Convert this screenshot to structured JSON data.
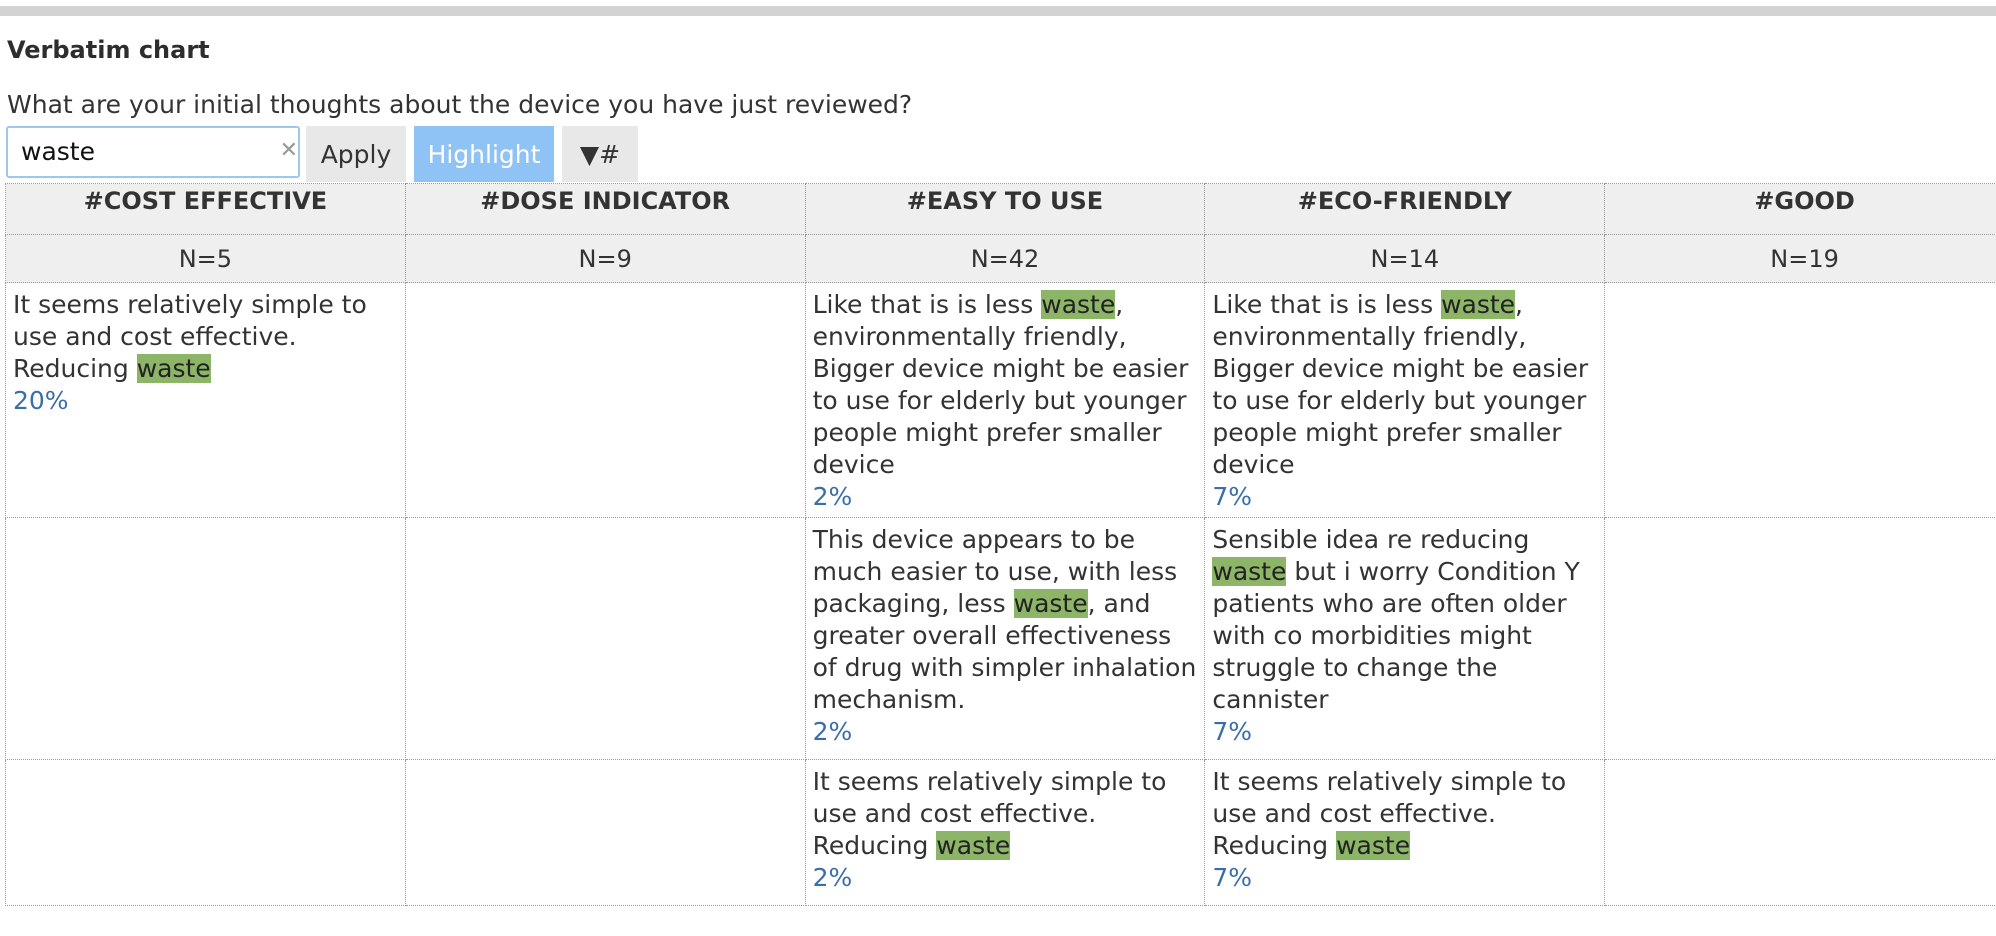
{
  "title": "Verbatim chart",
  "question": "What are your initial thoughts about the device you have just reviewed?",
  "search": {
    "value": "waste",
    "clear_icon": "close-icon"
  },
  "toolbar": {
    "apply_label": "Apply",
    "highlight_label": "Highlight",
    "filter_label": "▼#"
  },
  "colors": {
    "highlight_bg": "#8cb567",
    "highlight_button": "#8fc3f5",
    "percent_text": "#3a6ea8"
  },
  "columns": [
    {
      "header": "#COST EFFECTIVE",
      "n": "N=5"
    },
    {
      "header": "#DOSE INDICATOR",
      "n": "N=9"
    },
    {
      "header": "#EASY TO USE",
      "n": "N=42"
    },
    {
      "header": "#ECO-FRIENDLY",
      "n": "N=14"
    },
    {
      "header": "#GOOD",
      "n": "N=19"
    }
  ],
  "rows": [
    [
      {
        "before": "It seems relatively simple to use and cost effective. Reducing ",
        "match": "waste",
        "after": "",
        "pct": "20%"
      },
      null,
      {
        "before": "Like that is is less ",
        "match": "waste",
        "after": ", environmentally friendly, Bigger device might be easier to use for elderly but younger people might prefer smaller device",
        "pct": "2%"
      },
      {
        "before": "Like that is is less ",
        "match": "waste",
        "after": ", environmentally friendly, Bigger device might be easier to use for elderly but younger people might prefer smaller device",
        "pct": "7%"
      },
      null
    ],
    [
      null,
      null,
      {
        "before": "This device appears to be much easier to use, with less packaging, less ",
        "match": "waste",
        "after": ", and greater overall effectiveness of drug with simpler inhalation mechanism.",
        "pct": "2%"
      },
      {
        "before": "Sensible idea re reducing ",
        "match": "waste",
        "after": " but i worry Condition Y patients who are often older with co morbidities might struggle to change the cannister",
        "pct": "7%"
      },
      null
    ],
    [
      null,
      null,
      {
        "before": "It seems relatively simple to use and cost effective. Reducing ",
        "match": "waste",
        "after": "",
        "pct": "2%"
      },
      {
        "before": "It seems relatively simple to use and cost effective. Reducing ",
        "match": "waste",
        "after": "",
        "pct": "7%"
      },
      null
    ]
  ]
}
